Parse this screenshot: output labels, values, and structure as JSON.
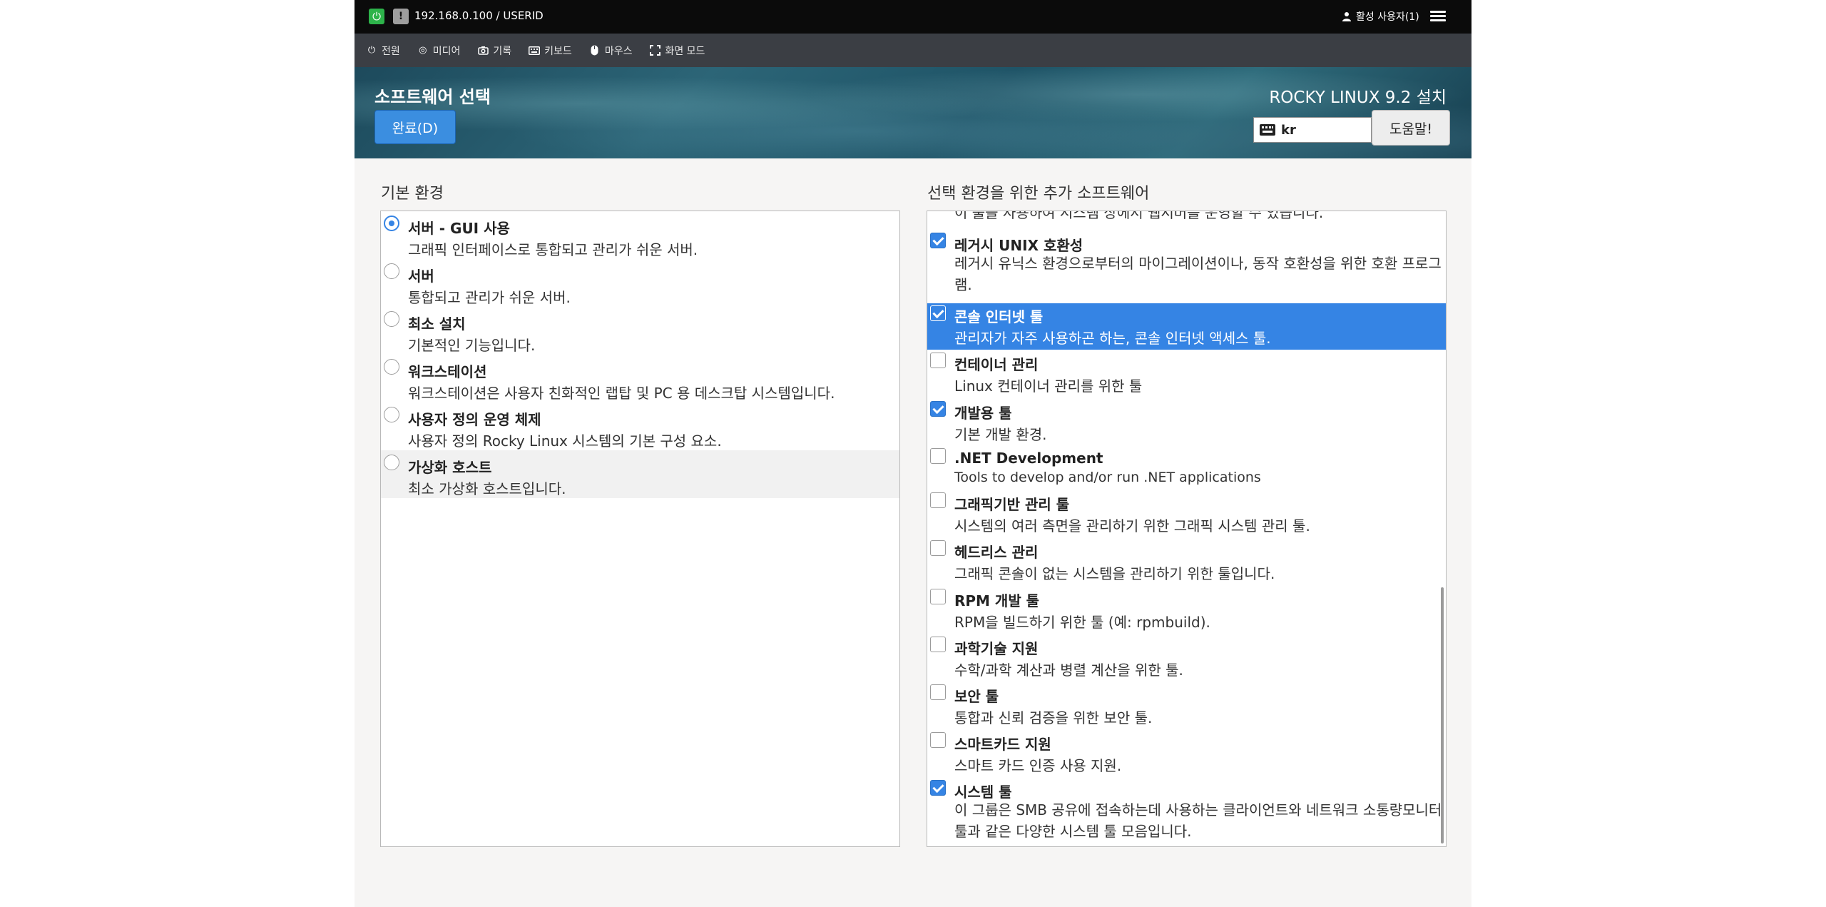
{
  "topbar": {
    "address": "192.168.0.100 / USERID",
    "active_users": "활성 사용자(1)"
  },
  "toolbar": {
    "items": [
      {
        "label": "전원",
        "icon": "power-icon"
      },
      {
        "label": "미디어",
        "icon": "disc-icon"
      },
      {
        "label": "기록",
        "icon": "camera-icon"
      },
      {
        "label": "키보드",
        "icon": "keyboard-icon"
      },
      {
        "label": "마우스",
        "icon": "mouse-icon"
      },
      {
        "label": "화면 모드",
        "icon": "fullscreen-icon"
      }
    ]
  },
  "header": {
    "title": "소프트웨어 선택",
    "done_label": "완료(D)",
    "product": "ROCKY LINUX 9.2 설치",
    "keyboard_layout": "kr",
    "help_label": "도움말!"
  },
  "base_env": {
    "title": "기본 환경",
    "items": [
      {
        "name": "서버 - GUI 사용",
        "desc": "그래픽 인터페이스로 통합되고 관리가 쉬운 서버.",
        "selected": true
      },
      {
        "name": "서버",
        "desc": "통합되고 관리가 쉬운 서버.",
        "selected": false
      },
      {
        "name": "최소 설치",
        "desc": "기본적인 기능입니다.",
        "selected": false
      },
      {
        "name": "워크스테이션",
        "desc": "워크스테이션은 사용자 친화적인 랩탑 및 PC 용 데스크탑 시스템입니다.",
        "selected": false
      },
      {
        "name": "사용자 정의 운영 체제",
        "desc": "사용자 정의 Rocky Linux 시스템의 기본 구성 요소.",
        "selected": false
      },
      {
        "name": "가상화 호스트",
        "desc": "최소 가상화 호스트입니다.",
        "selected": false
      }
    ]
  },
  "addons": {
    "title": "선택 환경을 위한 추가 소프트웨어",
    "partial_top": "이 툴을 사용하여 시스템 상에서 웹서버를 운영할 수 있습니다.",
    "items": [
      {
        "name": "레거시 UNIX 호환성",
        "desc": "레거시 유닉스 환경으로부터의 마이그레이션이나, 동작 호환성을 위한 호환 프로그램.",
        "checked": true
      },
      {
        "name": "콘솔 인터넷 툴",
        "desc": "관리자가 자주 사용하곤 하는, 콘솔 인터넷 액세스 툴.",
        "checked": true
      },
      {
        "name": "컨테이너 관리",
        "desc": "Linux 컨테이너 관리를 위한 툴",
        "checked": false
      },
      {
        "name": "개발용 툴",
        "desc": "기본 개발 환경.",
        "checked": true
      },
      {
        "name": ".NET Development",
        "desc": "Tools to develop and/or run .NET applications",
        "checked": false
      },
      {
        "name": "그래픽기반 관리 툴",
        "desc": "시스템의 여러 측면을 관리하기 위한 그래픽 시스템 관리 툴.",
        "checked": false
      },
      {
        "name": "헤드리스 관리",
        "desc": "그래픽 콘솔이 없는 시스템을 관리하기 위한 툴입니다.",
        "checked": false
      },
      {
        "name": "RPM 개발 툴",
        "desc": "RPM을 빌드하기 위한 툴 (예: rpmbuild).",
        "checked": false
      },
      {
        "name": "과학기술 지원",
        "desc": "수학/과학 계산과 병렬 계산을 위한 툴.",
        "checked": false
      },
      {
        "name": "보안 툴",
        "desc": "통합과 신뢰 검증을 위한 보안 툴.",
        "checked": false
      },
      {
        "name": "스마트카드 지원",
        "desc": "스마트 카드 인증 사용 지원.",
        "checked": false
      },
      {
        "name": "시스템 툴",
        "desc": "이 그룹은 SMB 공유에 접속하는데 사용하는 클라이언트와 네트워크 소통량모니터 툴과 같은 다양한 시스템 툴 모음입니다.",
        "checked": true
      }
    ]
  }
}
